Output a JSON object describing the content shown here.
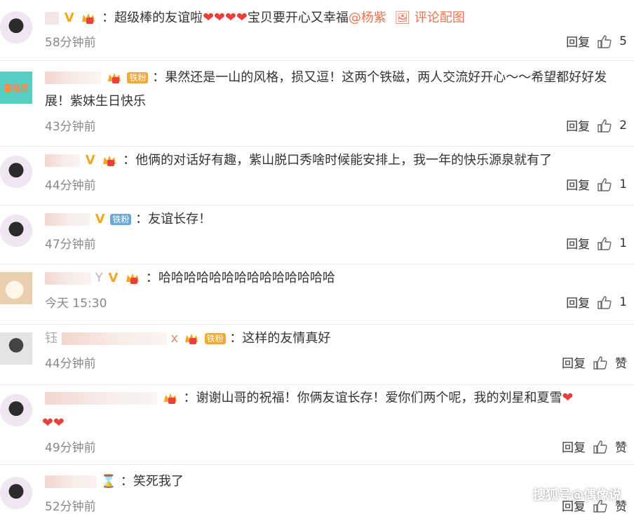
{
  "comments": [
    {
      "text": "：超级棒的友谊啦",
      "hearts": "❤❤❤❤",
      "text2": "宝贝要开心又幸福",
      "mention": "@杨紫",
      "pic_label": "评论配图",
      "time": "58分钟前",
      "reply": "回复",
      "likes": "5"
    },
    {
      "fan_label": "铁粉",
      "text": "：果然还是一山的风格，损又逗！这两个铁磁，两人交流好开心～～希望都好好发展！紫妹生日快乐",
      "avatar_text": "星姐员",
      "time": "43分钟前",
      "reply": "回复",
      "likes": "2"
    },
    {
      "text": "：他俩的对话好有趣，紫山脱口秀啥时候能安排上，我一年的快乐源泉就有了",
      "time": "44分钟前",
      "reply": "回复",
      "likes": "1"
    },
    {
      "fan_label": "铁粉",
      "text": "：友谊长存！",
      "time": "47分钟前",
      "reply": "回复",
      "likes": "1"
    },
    {
      "name_suffix": "Y",
      "text": "：哈哈哈哈哈哈哈哈哈哈哈哈哈哈",
      "time": "今天 15:30",
      "reply": "回复",
      "likes": "1"
    },
    {
      "name_prefix": "钰",
      "name_suffix": "x",
      "fan_label": "铁粉",
      "text": "：这样的友情真好",
      "time": "44分钟前",
      "reply": "回复",
      "likes": "赞"
    },
    {
      "text": "：谢谢山哥的祝福！你俩友谊长存！爱你们两个呢，我的刘星和夏雪",
      "hearts_end": "❤",
      "hearts_line2": "❤❤",
      "time": "49分钟前",
      "reply": "回复",
      "likes": "赞"
    },
    {
      "text": "：笑死我了",
      "time": "52分钟前",
      "reply": "回复",
      "likes": "赞"
    }
  ],
  "watermark": "搜狐号@偶像说",
  "colors": {
    "link": "#eb7350",
    "verified": "#f5a623",
    "heart": "#e8413b",
    "meta": "#888888"
  }
}
